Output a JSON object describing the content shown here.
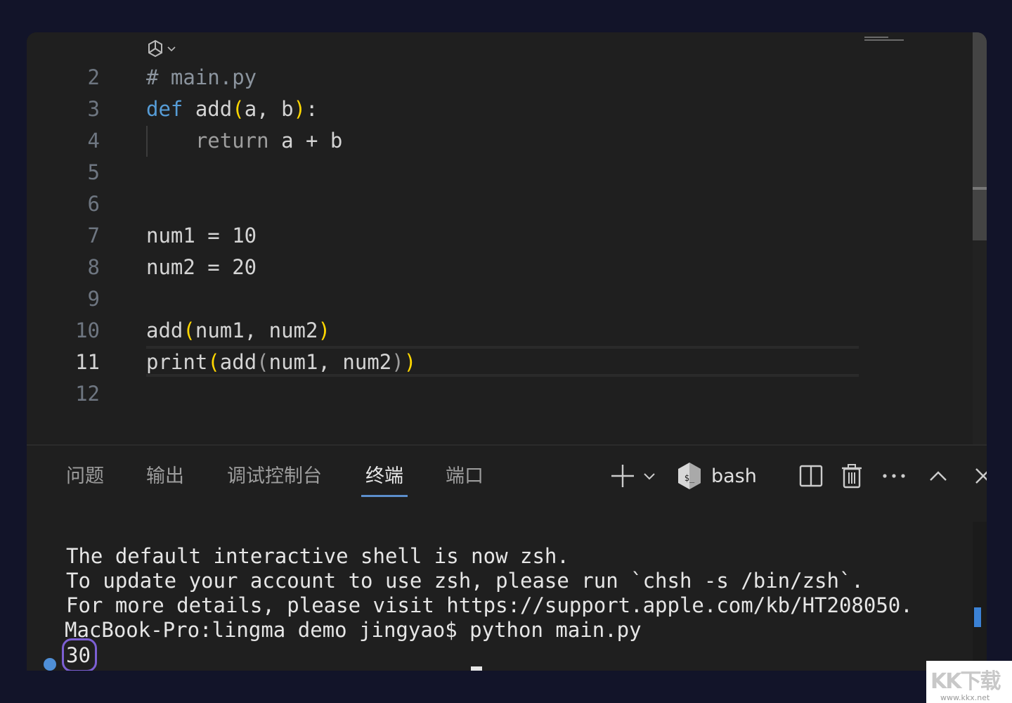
{
  "editor": {
    "lines": [
      {
        "no": "2",
        "text": "# main.py"
      },
      {
        "no": "3",
        "text": "def add(a, b):"
      },
      {
        "no": "4",
        "text": "    return a + b"
      },
      {
        "no": "5",
        "text": ""
      },
      {
        "no": "6",
        "text": ""
      },
      {
        "no": "7",
        "text": "num1 = 10"
      },
      {
        "no": "8",
        "text": "num2 = 20"
      },
      {
        "no": "9",
        "text": ""
      },
      {
        "no": "10",
        "text": "add(num1, num2)"
      },
      {
        "no": "11",
        "text": "print(add(num1, num2))"
      },
      {
        "no": "12",
        "text": ""
      }
    ],
    "active_line": "11",
    "tokens": {
      "comment": "# main.py",
      "def_kw": "def",
      "add_name": " add",
      "paren_open": "(",
      "args": "a, b",
      "paren_close": ")",
      "colon": ":",
      "return_kw": "return",
      "return_expr": " a + b",
      "num1_assign": "num1 = 10",
      "num2_assign": "num2 = 20",
      "call_add": "add",
      "call_args": "num1, num2",
      "print_fn": "print",
      "inner_add": "add",
      "inner_args": "num1, num2"
    }
  },
  "panel": {
    "tabs": [
      {
        "label": "问题"
      },
      {
        "label": "输出"
      },
      {
        "label": "调试控制台"
      },
      {
        "label": "终端"
      },
      {
        "label": "端口"
      }
    ],
    "active_tab": "终端",
    "shell_label": "bash"
  },
  "terminal": {
    "lines": [
      "The default interactive shell is now zsh.",
      "To update your account to use zsh, please run `chsh -s /bin/zsh`.",
      "For more details, please visit https://support.apple.com/kb/HT208050.",
      "MacBook-Pro:lingma demo jingyao$ python main.py",
      "30"
    ]
  },
  "watermark": {
    "logo": "KK下载",
    "url": "www.kkx.net"
  },
  "icons": {
    "ai": "ai-assistant-icon",
    "add": "plus-icon",
    "chevron": "chevron-down-icon",
    "bash": "bash-shell-icon",
    "split": "split-terminal-icon",
    "trash": "trash-icon",
    "more": "more-icon",
    "maximize": "chevron-up-icon",
    "close": "close-icon"
  },
  "colors": {
    "keyword": "#569cd6",
    "bracket": "#ffd700",
    "tab_underline": "#5c8ecc",
    "ring": "#7c5fd3",
    "status_dot": "#4f8fd6"
  }
}
